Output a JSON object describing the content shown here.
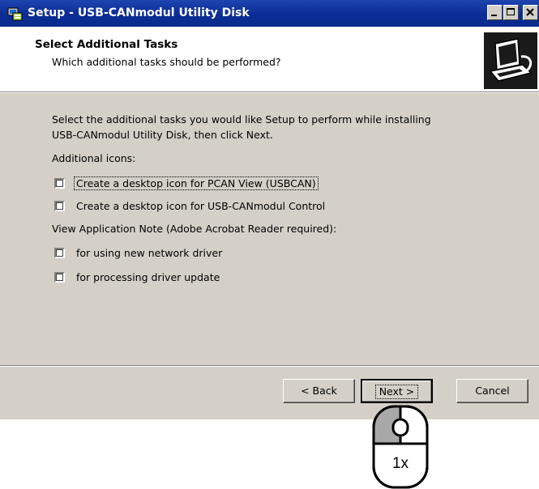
{
  "window": {
    "title": "Setup - USB-CANmodul Utility Disk",
    "controls": [
      "minimize",
      "maximize",
      "close"
    ]
  },
  "header": {
    "title": "Select Additional Tasks",
    "subtitle": "Which additional tasks should be performed?"
  },
  "content": {
    "intro_line1": "Select the additional tasks you would like Setup to perform while installing",
    "intro_line2": "USB-CANmodul Utility Disk, then click Next.",
    "group1_label": "Additional icons:",
    "group1_items": [
      {
        "label": "Create a desktop icon for PCAN View (USBCAN)",
        "checked": false
      },
      {
        "label": "Create a desktop icon for USB-CANmodul Control",
        "checked": false
      }
    ],
    "group2_label": "View Application Note (Adobe Acrobat Reader required):",
    "group2_items": [
      {
        "label": "for using new network driver",
        "checked": false
      },
      {
        "label": "for processing driver update",
        "checked": false
      }
    ]
  },
  "buttons": {
    "back": "< Back",
    "next": "Next >",
    "cancel": "Cancel"
  },
  "annotation": {
    "mouse_clicks": "1x"
  },
  "colors": {
    "titlebar": "#0a2a8c",
    "dialog_face": "#d4d0c8",
    "header_bg": "#ffffff"
  }
}
